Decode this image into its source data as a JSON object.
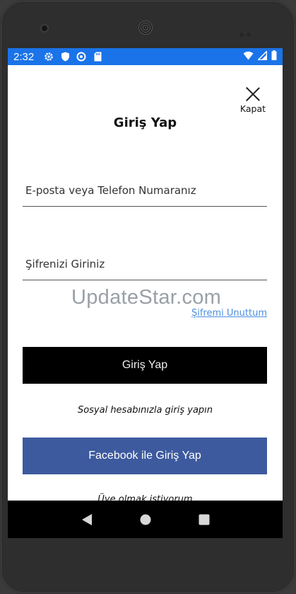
{
  "status_bar": {
    "time": "2:32",
    "background_color": "#1a73e8",
    "left_icons": [
      "settings-icon",
      "shield-icon",
      "sync-icon",
      "sdcard-icon"
    ],
    "right_icons": [
      "wifi-icon",
      "signal-icon",
      "battery-icon"
    ]
  },
  "header": {
    "close_label": "Kapat",
    "title": "Giriş Yap"
  },
  "form": {
    "email_placeholder": "E-posta veya Telefon Numaranız",
    "password_placeholder": "Şifrenizi Giriniz",
    "forgot_password": "Şifremi Unuttum",
    "login_button": "Giriş Yap"
  },
  "watermark": "UpdateStar.com",
  "social": {
    "prompt": "Sosyal hesabınızla giriş yapın",
    "facebook_button": "Facebook ile Giriş Yap",
    "facebook_color": "#3d5a9e"
  },
  "register_text": "Üye olmak istiyorum",
  "navigation": {
    "icons": [
      "back-icon",
      "home-icon",
      "recents-icon"
    ]
  }
}
